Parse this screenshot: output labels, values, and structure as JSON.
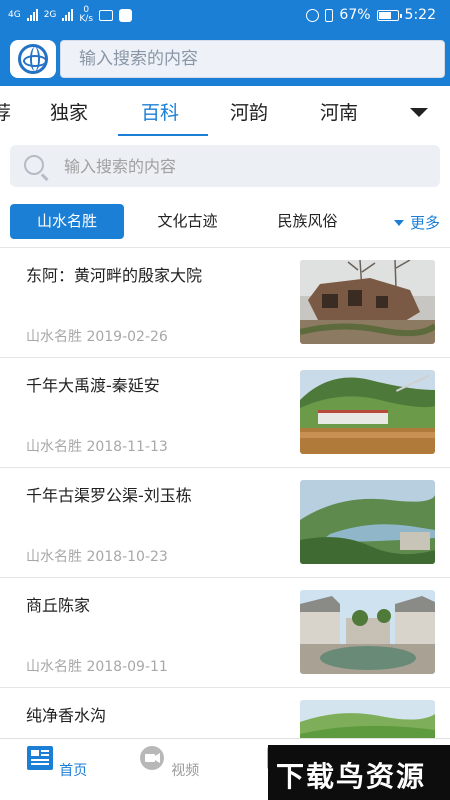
{
  "status_bar": {
    "left_signal1_label": "4G",
    "left_signal2_label": "2G",
    "speed_value": "0",
    "speed_unit": "K/s",
    "battery_percent": "67%",
    "time": "5:22"
  },
  "header": {
    "search_placeholder": "输入搜索的内容"
  },
  "tabs": {
    "items": [
      {
        "label": "荐"
      },
      {
        "label": "独家"
      },
      {
        "label": "百科"
      },
      {
        "label": "河韵"
      },
      {
        "label": "河南"
      }
    ],
    "active_index": 2
  },
  "search": {
    "placeholder": "输入搜索的内容"
  },
  "categories": {
    "items": [
      {
        "label": "山水名胜"
      },
      {
        "label": "文化古迹"
      },
      {
        "label": "民族风俗"
      }
    ],
    "active_index": 0,
    "more_label": "更多"
  },
  "articles": [
    {
      "title": "东阿：黄河畔的殷家大院",
      "category": "山水名胜",
      "date": "2019-02-26"
    },
    {
      "title": "千年大禹渡-秦延安",
      "category": "山水名胜",
      "date": "2018-11-13"
    },
    {
      "title": "千年古渠罗公渠-刘玉栋",
      "category": "山水名胜",
      "date": "2018-10-23"
    },
    {
      "title": "商丘陈家",
      "category": "山水名胜",
      "date": "2018-09-11"
    },
    {
      "title": "纯净香水沟",
      "category": "",
      "date": ""
    }
  ],
  "bottom_nav": {
    "items": [
      {
        "label": "首页",
        "icon": "home-news-icon"
      },
      {
        "label": "视频",
        "icon": "video-icon"
      },
      {
        "label": "",
        "icon": "partial-icon"
      }
    ],
    "active_index": 0
  },
  "watermark": {
    "text": "下载鸟资源"
  },
  "colors": {
    "brand": "#1b7fd6",
    "muted": "#a8a8a8"
  }
}
